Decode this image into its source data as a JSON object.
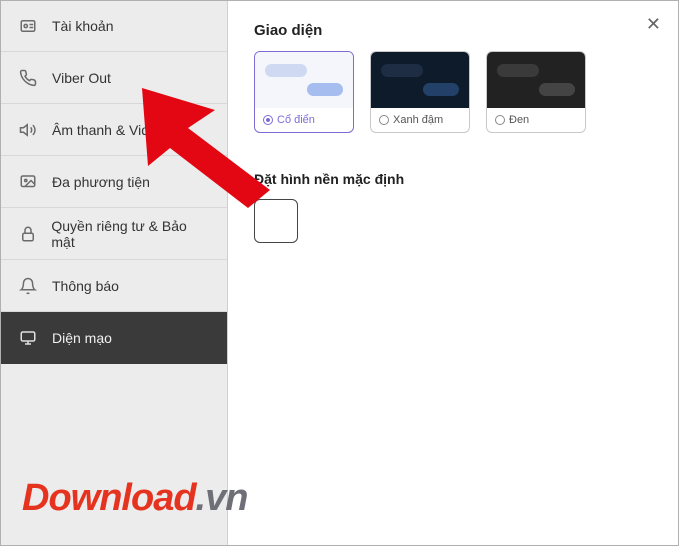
{
  "sidebar": {
    "items": [
      {
        "label": "Tài khoản",
        "icon": "account-icon"
      },
      {
        "label": "Viber Out",
        "icon": "phone-icon"
      },
      {
        "label": "Âm thanh & Video",
        "icon": "speaker-icon"
      },
      {
        "label": "Đa phương tiện",
        "icon": "image-icon"
      },
      {
        "label": "Quyền riêng tư & Bảo mật",
        "icon": "lock-icon"
      },
      {
        "label": "Thông báo",
        "icon": "bell-icon"
      },
      {
        "label": "Diện mạo",
        "icon": "appearance-icon"
      }
    ],
    "active_index": 6
  },
  "main": {
    "section_title": "Giao diện",
    "themes": [
      {
        "label": "Cổ điển",
        "selected": true
      },
      {
        "label": "Xanh đậm",
        "selected": false
      },
      {
        "label": "Đen",
        "selected": false
      }
    ],
    "background_section_title": "Đặt hình nền mặc định"
  },
  "watermark": {
    "part1": "Download",
    "part2": ".vn"
  }
}
